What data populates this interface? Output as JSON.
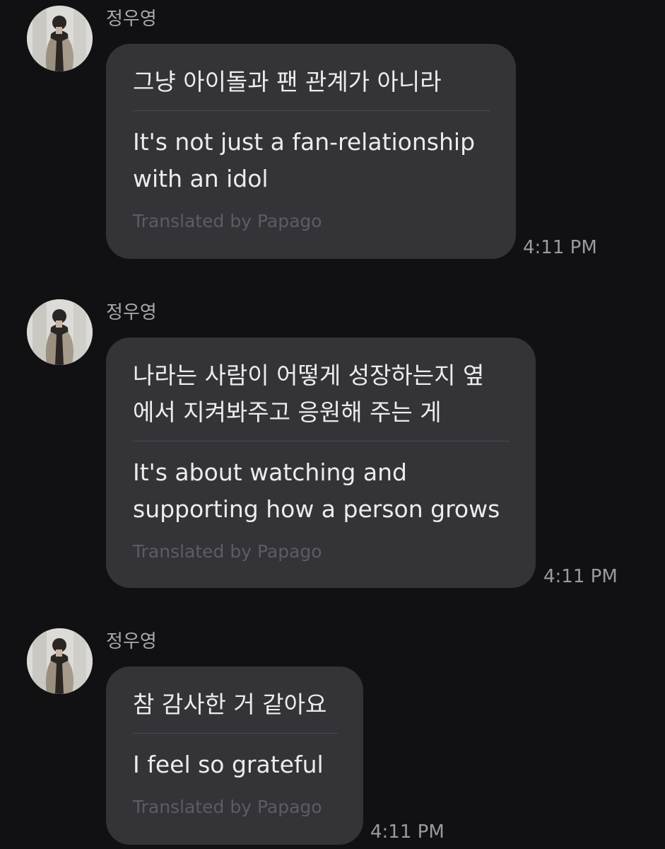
{
  "messages": [
    {
      "sender": "정우영",
      "avatar_icon": "profile-photo-icon",
      "original": "그냥 아이돌과 팬 관계가 아니라",
      "translation": "It's not just a fan-relationship\nwith an idol",
      "credit": "Translated by Papago",
      "time": "4:11 PM"
    },
    {
      "sender": "정우영",
      "avatar_icon": "profile-photo-icon",
      "original": "나라는 사람이 어떻게 성장하는지 옆\n에서 지켜봐주고 응원해 주는 게",
      "translation": "It's about watching and\nsupporting how a person grows",
      "credit": "Translated by Papago",
      "time": "4:11 PM"
    },
    {
      "sender": "정우영",
      "avatar_icon": "profile-photo-icon",
      "original": "참 감사한 거 같아요",
      "translation": "I feel so grateful",
      "credit": "Translated by Papago",
      "time": "4:11 PM"
    }
  ],
  "colors": {
    "background": "#111114",
    "bubble": "#333338",
    "credit_text": "#5c5c63"
  }
}
